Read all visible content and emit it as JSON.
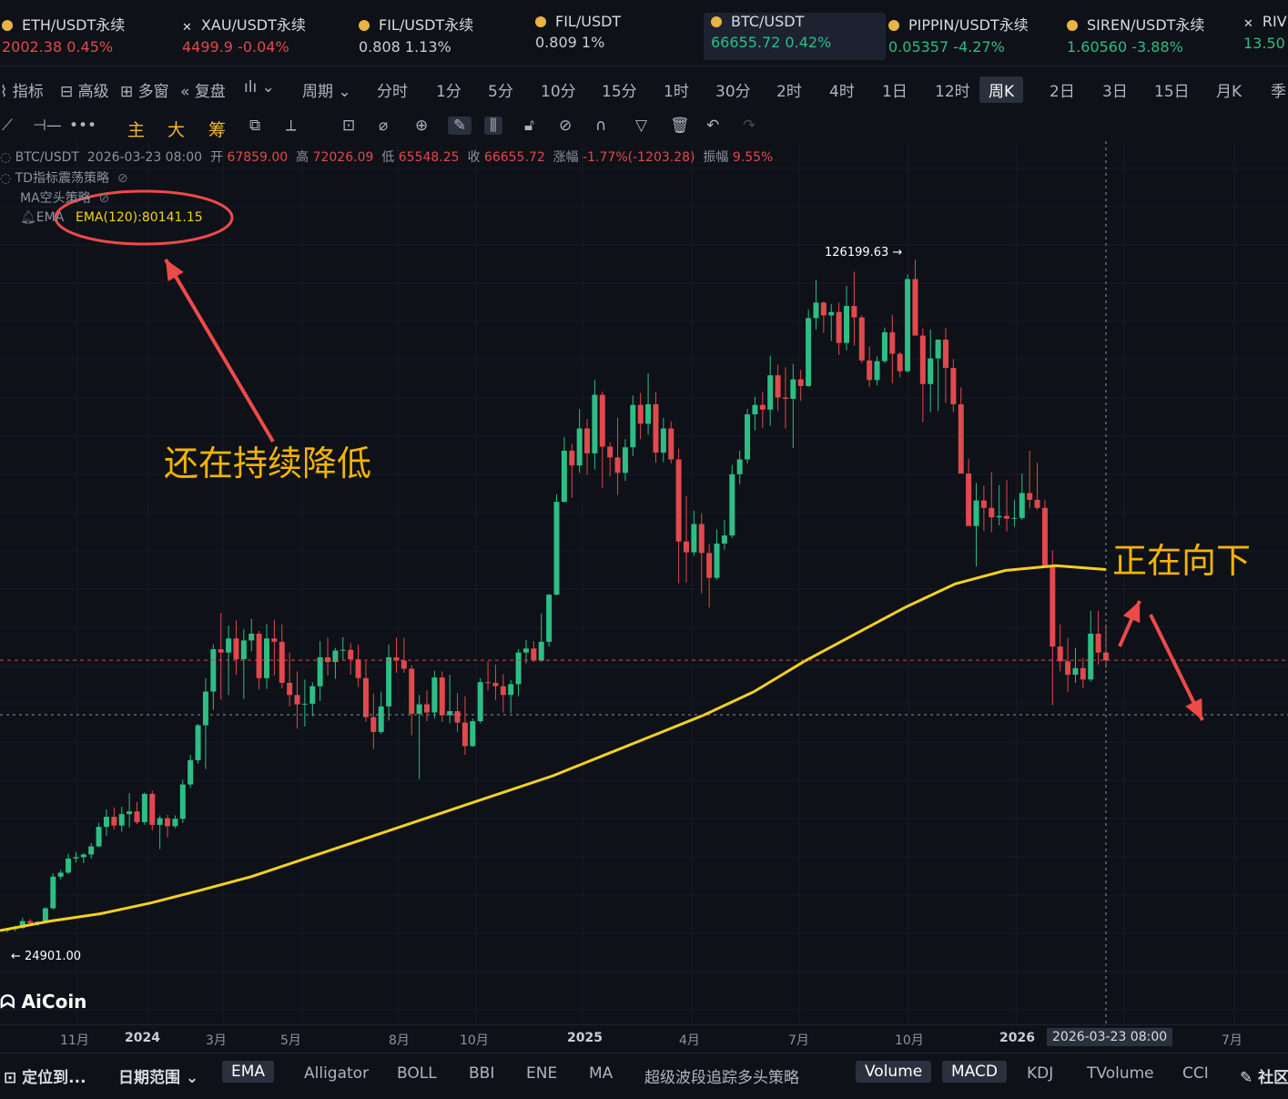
{
  "tickers": [
    {
      "name": "ETH/USDT永续",
      "price": "2002.38",
      "change": "0.45%",
      "dir": "dn",
      "icon": "coin-icon"
    },
    {
      "name": "XAU/USDT永续",
      "price": "4499.9",
      "change": "-0.04%",
      "dir": "dn",
      "icon": "x-icon"
    },
    {
      "name": "FIL/USDT永续",
      "price": "0.808",
      "change": "1.13%",
      "dir": "neu",
      "icon": "coin-icon"
    },
    {
      "name": "FIL/USDT",
      "price": "0.809",
      "change": "1%",
      "dir": "neu",
      "icon": "coin-icon"
    },
    {
      "name": "BTC/USDT",
      "price": "66655.72",
      "change": "0.42%",
      "dir": "up",
      "icon": "coin-icon"
    },
    {
      "name": "PIPPIN/USDT永续",
      "price": "0.05357",
      "change": "-4.27%",
      "dir": "up",
      "icon": "coin-icon"
    },
    {
      "name": "SIREN/USDT永续",
      "price": "1.60560",
      "change": "-3.88%",
      "dir": "up",
      "icon": "coin-icon"
    },
    {
      "name": "RIV",
      "price": "13.50",
      "change": "",
      "dir": "up",
      "icon": "x-icon"
    }
  ],
  "toolbar_left": {
    "indicators": "指标",
    "advanced": "高级",
    "multi": "多窗",
    "replay": "复盘",
    "period": "周期"
  },
  "timeframes": [
    "分时",
    "1分",
    "5分",
    "10分",
    "15分",
    "1时",
    "30分",
    "2时",
    "4时",
    "1日",
    "12时",
    "周K",
    "2日",
    "3日",
    "15日",
    "月K",
    "季"
  ],
  "selected_timeframe": "周K",
  "draw_tools": {
    "main": "主",
    "big": "大",
    "chips": "筹"
  },
  "legend": {
    "symbol": "BTC/USDT",
    "datetime": "2026-03-23 08:00",
    "open_label": "开",
    "open": "67859.00",
    "high_label": "高",
    "high": "72026.09",
    "low_label": "低",
    "low": "65548.25",
    "close_label": "收",
    "close": "66655.72",
    "chg_label": "涨幅",
    "chg": "-1.77%(-1203.28)",
    "amp_label": "振幅",
    "amp": "9.55%",
    "td": "TD指标震荡策略",
    "ma": "MA空头策略",
    "ema_prefix": "EMA",
    "ema": "EMA(120):80141.15"
  },
  "annotations": {
    "left": "还在持续降低",
    "right": "正在向下"
  },
  "price_marks": {
    "high": "126199.63",
    "low": "24901.00"
  },
  "logo": "AiCoin",
  "x_axis": [
    "11月",
    "2024",
    "3月",
    "5月",
    "8月",
    "10月",
    "2025",
    "4月",
    "7月",
    "10月",
    "2026",
    "2026-03-23 08:00",
    "7月"
  ],
  "bottom_left": {
    "locate": "定位到...",
    "range": "日期范围"
  },
  "indicators": [
    "EMA",
    "Alligator",
    "BOLL",
    "BBI",
    "ENE",
    "MA",
    "超级波段追踪多头策略",
    "Volume",
    "MACD",
    "KDJ",
    "TVolume",
    "CCI",
    "社区"
  ],
  "colors": {
    "up": "#2ebd85",
    "down": "#e0494d",
    "ema": "#f5d020",
    "annotation": "#f5b400",
    "arrow": "#ee4a4a"
  },
  "chart_data": {
    "type": "candlestick",
    "symbol": "BTC/USDT",
    "interval": "周K",
    "ylim": [
      20000,
      135000
    ],
    "candles": [
      [
        26500,
        26800,
        26200,
        26700
      ],
      [
        26700,
        27200,
        26400,
        26900
      ],
      [
        26900,
        28400,
        26700,
        27900
      ],
      [
        27900,
        28200,
        27400,
        27600
      ],
      [
        27600,
        27900,
        27200,
        27800
      ],
      [
        27800,
        30000,
        27600,
        29800
      ],
      [
        29800,
        35000,
        29600,
        34500
      ],
      [
        34500,
        35500,
        34100,
        35100
      ],
      [
        35100,
        37900,
        34900,
        37200
      ],
      [
        37200,
        38200,
        36600,
        37400
      ],
      [
        37400,
        38000,
        36500,
        37800
      ],
      [
        37800,
        39500,
        37200,
        39000
      ],
      [
        39000,
        42500,
        38900,
        41900
      ],
      [
        41900,
        44500,
        40600,
        43400
      ],
      [
        43400,
        44800,
        41500,
        42100
      ],
      [
        42100,
        44900,
        41200,
        43800
      ],
      [
        43800,
        46900,
        41800,
        44200
      ],
      [
        44200,
        45600,
        42300,
        42600
      ],
      [
        42600,
        47000,
        42200,
        46800
      ],
      [
        46800,
        47300,
        41400,
        42200
      ],
      [
        42200,
        43600,
        38600,
        43200
      ],
      [
        43200,
        43700,
        40300,
        42000
      ],
      [
        42000,
        43600,
        41700,
        43100
      ],
      [
        43100,
        48900,
        42500,
        48200
      ],
      [
        48200,
        52600,
        47700,
        51800
      ],
      [
        51800,
        57200,
        51300,
        57000
      ],
      [
        57000,
        64000,
        50500,
        62000
      ],
      [
        62000,
        69000,
        59300,
        68300
      ],
      [
        68300,
        73700,
        60800,
        67800
      ],
      [
        67800,
        71800,
        61500,
        69900
      ],
      [
        69900,
        72600,
        64500,
        66800
      ],
      [
        66800,
        71300,
        60900,
        69600
      ],
      [
        69600,
        72800,
        68000,
        70600
      ],
      [
        70600,
        71000,
        62300,
        64000
      ],
      [
        64000,
        72000,
        62400,
        69900
      ],
      [
        69900,
        72700,
        64400,
        69400
      ],
      [
        69400,
        72000,
        62500,
        63300
      ],
      [
        63300,
        67800,
        59800,
        61500
      ],
      [
        61500,
        65000,
        56500,
        60100
      ],
      [
        60100,
        63800,
        56800,
        60200
      ],
      [
        60200,
        63400,
        58300,
        62800
      ],
      [
        62800,
        69500,
        60600,
        67100
      ],
      [
        67100,
        70000,
        64400,
        66400
      ],
      [
        66400,
        68500,
        63900,
        68100
      ],
      [
        68100,
        70100,
        66600,
        68200
      ],
      [
        68200,
        69200,
        64500,
        66800
      ],
      [
        66800,
        69000,
        62700,
        64000
      ],
      [
        64000,
        66500,
        57500,
        58200
      ],
      [
        58200,
        61700,
        53500,
        56000
      ],
      [
        56000,
        62000,
        55700,
        59800
      ],
      [
        59800,
        69000,
        57700,
        67100
      ],
      [
        67100,
        70000,
        64800,
        66600
      ],
      [
        66600,
        70000,
        64800,
        65400
      ],
      [
        65400,
        65900,
        55500,
        58700
      ],
      [
        58700,
        61500,
        49000,
        60100
      ],
      [
        60100,
        62200,
        57600,
        58900
      ],
      [
        58900,
        65100,
        58000,
        64100
      ],
      [
        64100,
        65000,
        57500,
        58500
      ],
      [
        58500,
        64500,
        57300,
        59100
      ],
      [
        59100,
        61800,
        56000,
        57400
      ],
      [
        57400,
        61300,
        52600,
        53900
      ],
      [
        53900,
        58000,
        53800,
        57600
      ],
      [
        57600,
        64000,
        57300,
        63400
      ],
      [
        63400,
        66500,
        62200,
        63300
      ],
      [
        63300,
        66000,
        60700,
        62800
      ],
      [
        62800,
        64600,
        58900,
        61500
      ],
      [
        61500,
        63700,
        58800,
        63100
      ],
      [
        63100,
        68300,
        61300,
        67800
      ],
      [
        67800,
        69700,
        66200,
        68400
      ],
      [
        68400,
        69500,
        66400,
        66600
      ],
      [
        66600,
        73600,
        66400,
        69400
      ],
      [
        69400,
        76500,
        68700,
        76400
      ],
      [
        76400,
        91300,
        76300,
        90200
      ],
      [
        90200,
        99800,
        90100,
        97800
      ],
      [
        97800,
        98800,
        90800,
        95600
      ],
      [
        95600,
        104000,
        94500,
        101100
      ],
      [
        101100,
        102500,
        94200,
        97400
      ],
      [
        97400,
        108300,
        95000,
        106100
      ],
      [
        106100,
        106600,
        92200,
        98400
      ],
      [
        98400,
        99000,
        94000,
        96800
      ],
      [
        96800,
        102700,
        91200,
        94500
      ],
      [
        94500,
        99500,
        93300,
        98300
      ],
      [
        98300,
        106000,
        97000,
        104600
      ],
      [
        104600,
        106400,
        99500,
        101800
      ],
      [
        101800,
        109300,
        100200,
        104700
      ],
      [
        104700,
        106500,
        96000,
        97500
      ],
      [
        97500,
        102700,
        96100,
        101100
      ],
      [
        101100,
        102200,
        95900,
        96500
      ],
      [
        96500,
        98100,
        78100,
        84300
      ],
      [
        84300,
        91100,
        78200,
        82700
      ],
      [
        82700,
        88900,
        82200,
        86900
      ],
      [
        86900,
        88500,
        76600,
        82600
      ],
      [
        82600,
        84000,
        74500,
        78900
      ],
      [
        78900,
        86100,
        78600,
        84000
      ],
      [
        84000,
        87500,
        83100,
        85200
      ],
      [
        85200,
        95700,
        84800,
        94300
      ],
      [
        94300,
        97800,
        92800,
        96500
      ],
      [
        96500,
        104000,
        95900,
        103200
      ],
      [
        103200,
        105800,
        100800,
        104600
      ],
      [
        104600,
        106600,
        101200,
        103900
      ],
      [
        103900,
        111900,
        101500,
        109000
      ],
      [
        109000,
        110600,
        103700,
        105700
      ],
      [
        105700,
        110200,
        101100,
        105500
      ],
      [
        105500,
        110700,
        98200,
        108400
      ],
      [
        108400,
        109800,
        105200,
        107400
      ],
      [
        107400,
        118800,
        107300,
        117500
      ],
      [
        117500,
        123200,
        115800,
        119800
      ],
      [
        119800,
        120000,
        115300,
        117900
      ],
      [
        117900,
        119600,
        114100,
        118400
      ],
      [
        118400,
        119800,
        112000,
        113800
      ],
      [
        113800,
        122300,
        112700,
        119300
      ],
      [
        119300,
        124400,
        113400,
        117600
      ],
      [
        117600,
        117900,
        110800,
        111200
      ],
      [
        111200,
        113300,
        107300,
        108300
      ],
      [
        108300,
        111800,
        107500,
        111100
      ],
      [
        111100,
        116100,
        110800,
        115400
      ],
      [
        115400,
        118000,
        107800,
        112200
      ],
      [
        112200,
        112500,
        108700,
        109600
      ],
      [
        109600,
        124000,
        109400,
        123300
      ],
      [
        123300,
        126200,
        120300,
        114900
      ],
      [
        114900,
        116000,
        102000,
        107700
      ],
      [
        107700,
        115800,
        103500,
        111500
      ],
      [
        111500,
        113700,
        103700,
        114300
      ],
      [
        114300,
        116000,
        104900,
        110100
      ],
      [
        110100,
        111400,
        103500,
        104700
      ],
      [
        104700,
        107200,
        98900,
        94400
      ],
      [
        94400,
        96600,
        89300,
        86600
      ],
      [
        86600,
        93000,
        80600,
        90400
      ],
      [
        90400,
        92600,
        85900,
        89300
      ],
      [
        89300,
        94600,
        85700,
        87900
      ],
      [
        87900,
        92700,
        86700,
        88100
      ],
      [
        88100,
        93400,
        85800,
        87700
      ],
      [
        87700,
        90500,
        86500,
        87800
      ],
      [
        87800,
        94400,
        87500,
        91500
      ],
      [
        91500,
        97800,
        89200,
        90500
      ],
      [
        90500,
        96000,
        89000,
        89300
      ],
      [
        89300,
        90500,
        81000,
        80500
      ],
      [
        80500,
        83000,
        60000,
        68700
      ],
      [
        68700,
        72000,
        65000,
        66500
      ],
      [
        66500,
        70000,
        62000,
        64500
      ],
      [
        64500,
        68500,
        63300,
        65500
      ],
      [
        65500,
        67000,
        62500,
        63800
      ],
      [
        63800,
        74000,
        63500,
        70600
      ],
      [
        70600,
        74000,
        66000,
        67800
      ],
      [
        67800,
        72000,
        65500,
        66655
      ]
    ],
    "ema120": [
      26500,
      27900,
      29000,
      30600,
      32500,
      34500,
      37000,
      39500,
      42000,
      44500,
      47000,
      49500,
      52500,
      55500,
      58500,
      62000,
      66500,
      70500,
      74500,
      78000,
      80000,
      80700,
      80141
    ],
    "highest": 126199.63,
    "lowest": 24901.0,
    "current_price": 66655.72
  }
}
